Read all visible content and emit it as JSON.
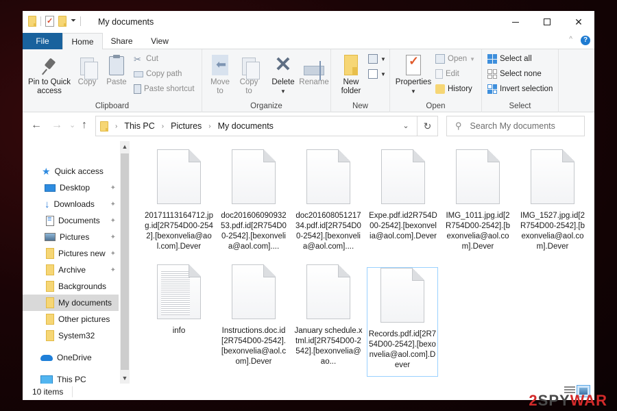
{
  "window": {
    "title": "My documents",
    "controls": {
      "minimize": "minimize",
      "maximize": "maximize",
      "close": "✕"
    }
  },
  "quick_access_toolbar": {
    "items": [
      "folder-icon",
      "properties-icon",
      "new-folder-icon",
      "customize-dropdown"
    ],
    "dropdown_glyph": "⏷"
  },
  "tabs": [
    {
      "label": "File"
    },
    {
      "label": "Home",
      "active": true
    },
    {
      "label": "Share"
    },
    {
      "label": "View"
    }
  ],
  "ribbon": {
    "collapse_glyph": "^",
    "help_glyph": "?",
    "groups": {
      "clipboard": {
        "label": "Clipboard",
        "pin_to_quick_access": "Pin to Quick access",
        "copy": "Copy",
        "paste": "Paste",
        "cut": "Cut",
        "copy_path": "Copy path",
        "paste_shortcut": "Paste shortcut"
      },
      "organize": {
        "label": "Organize",
        "move_to": "Move to",
        "copy_to": "Copy to",
        "delete": "Delete",
        "rename": "Rename"
      },
      "new": {
        "label": "New",
        "new_folder": "New folder"
      },
      "open": {
        "label": "Open",
        "properties": "Properties",
        "open": "Open",
        "edit": "Edit",
        "history": "History"
      },
      "select": {
        "label": "Select",
        "select_all": "Select all",
        "select_none": "Select none",
        "invert_selection": "Invert selection"
      }
    }
  },
  "navigation": {
    "back_glyph": "←",
    "forward_glyph": "→",
    "recent_glyph": "⌄",
    "up_glyph": "↑",
    "breadcrumb": [
      "This PC",
      "Pictures",
      "My documents"
    ],
    "breadcrumb_sep": "›",
    "dropdown_glyph": "⌄",
    "refresh_glyph": "↻",
    "search_placeholder": "Search My documents",
    "search_value": ""
  },
  "nav_pane": {
    "items": [
      {
        "label": "Quick access",
        "icon": "star-icon"
      },
      {
        "label": "Desktop",
        "icon": "desktop-icon",
        "pinned": true
      },
      {
        "label": "Downloads",
        "icon": "download-icon",
        "pinned": true
      },
      {
        "label": "Documents",
        "icon": "documents-icon",
        "pinned": true
      },
      {
        "label": "Pictures",
        "icon": "pictures-icon",
        "pinned": true
      },
      {
        "label": "Pictures new",
        "icon": "folder-icon",
        "pinned": true
      },
      {
        "label": "Archive",
        "icon": "folder-icon",
        "pinned": true
      },
      {
        "label": "Backgrounds",
        "icon": "folder-icon"
      },
      {
        "label": "My documents",
        "icon": "folder-icon",
        "selected": true
      },
      {
        "label": "Other pictures",
        "icon": "folder-icon"
      },
      {
        "label": "System32",
        "icon": "folder-icon"
      },
      {
        "label": "OneDrive",
        "icon": "onedrive-icon"
      },
      {
        "label": "This PC",
        "icon": "this-pc-icon"
      }
    ],
    "pin_glyph": "📌"
  },
  "files": [
    {
      "name": "20171113164712.jpg.id[2R754D00-2542].[bexonvelia@aol.com].Dever",
      "icon": "blank-file"
    },
    {
      "name": "doc20160609093253.pdf.id[2R754D00-2542].[bexonvelia@aol.com]....",
      "icon": "blank-file"
    },
    {
      "name": "doc20160805121734.pdf.id[2R754D00-2542].[bexonvelia@aol.com]....",
      "icon": "blank-file"
    },
    {
      "name": "Expe.pdf.id2R754D00-2542].[bexonvelia@aol.com].Dever",
      "icon": "blank-file"
    },
    {
      "name": "IMG_1011.jpg.id[2R754D00-2542].[bexonvelia@aol.com].Dever",
      "icon": "blank-file"
    },
    {
      "name": "IMG_1527.jpg.id[2R754D00-2542].[bexonvelia@aol.com].Dever",
      "icon": "blank-file"
    },
    {
      "name": "info",
      "icon": "text-file"
    },
    {
      "name": "Instructions.doc.id[2R754D00-2542].[bexonvelia@aol.com].Dever",
      "icon": "blank-file"
    },
    {
      "name": "January schedule.xtml.id[2R754D00-2542].[bexonvelia@ao...",
      "icon": "blank-file"
    },
    {
      "name": "Records.pdf.id[2R754D00-2542].[bexonvelia@aol.com].Dever",
      "icon": "blank-file",
      "selected": true
    }
  ],
  "status": {
    "item_count": "10 items"
  },
  "watermark": {
    "part1": "2",
    "part2": "SPY",
    "part3": "WAR"
  }
}
